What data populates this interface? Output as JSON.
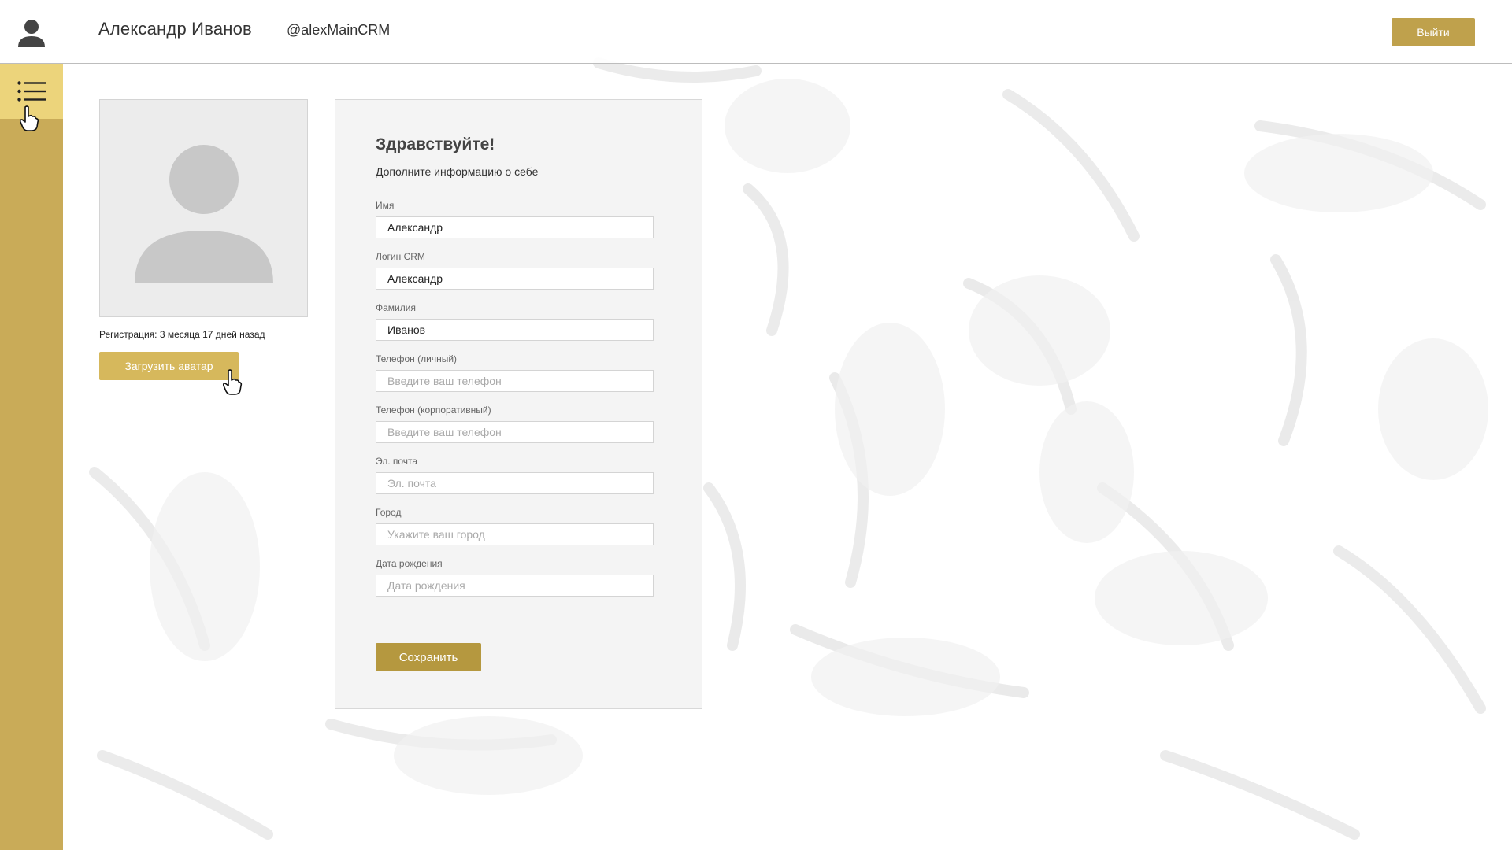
{
  "header": {
    "user_name": "Александр Иванов",
    "user_login": "@alexMainCRM",
    "logout_label": "Выйти"
  },
  "sidebar": {
    "menu_icon": "list-icon"
  },
  "profile": {
    "registration_text": "Регистрация: 3 месяца 17 дней назад",
    "upload_label": "Загрузить аватар"
  },
  "form": {
    "title": "Здравствуйте!",
    "subtitle": "Дополните информацию о себе",
    "fields": [
      {
        "label": "Имя",
        "value": "Александр",
        "placeholder": ""
      },
      {
        "label": "Логин CRM",
        "value": "Александр",
        "placeholder": ""
      },
      {
        "label": "Фамилия",
        "value": "Иванов",
        "placeholder": ""
      },
      {
        "label": "Телефон (личный)",
        "value": "",
        "placeholder": "Введите ваш телефон"
      },
      {
        "label": "Телефон (корпоративный)",
        "value": "",
        "placeholder": "Введите ваш телефон"
      },
      {
        "label": "Эл. почта",
        "value": "",
        "placeholder": "Эл. почта"
      },
      {
        "label": "Город",
        "value": "",
        "placeholder": "Укажите ваш город"
      },
      {
        "label": "Дата рождения",
        "value": "",
        "placeholder": "Дата рождения"
      }
    ],
    "save_label": "Сохранить"
  },
  "colors": {
    "accent": "#c9ab58",
    "accent_light": "#ecd47b",
    "button": "#bfa14c"
  }
}
